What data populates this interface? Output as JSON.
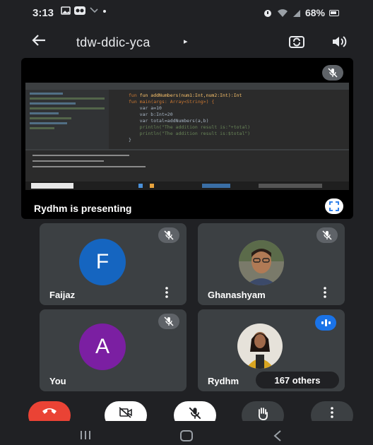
{
  "status_bar": {
    "time": "3:13",
    "battery": "68%",
    "left_icons": [
      "gallery-icon",
      "teams-icon",
      "signal-tool-icon",
      "dot-icon"
    ],
    "right_icons": [
      "alarm-icon",
      "wifi-icon",
      "signal-icon",
      "battery-icon"
    ]
  },
  "header": {
    "meeting_code": "tdw-ddic-yca",
    "caret": "▸"
  },
  "presentation": {
    "presenter_text": "Rydhm  is presenting",
    "code_lines": [
      "fun addNumbers(num1:Int,num2:Int):Int",
      "fun main(args: Array<String>) {",
      "    var a=10",
      "    var b:Int=20",
      "    var total=addNumbers(a,b)",
      "    println(\"The addition result is:\"+total)",
      "    println(\"The addition result is:$total\")",
      "}"
    ]
  },
  "participants": [
    {
      "name": "Faijaz",
      "initial": "F",
      "avatar_color": "#1565c0",
      "muted": true
    },
    {
      "name": "Ghanashyam",
      "initial": "",
      "avatar_color": "#6d5a4a",
      "muted": true
    },
    {
      "name": "You",
      "initial": "A",
      "avatar_color": "#7b1fa2",
      "muted": true
    },
    {
      "name": "Rydhm",
      "initial": "",
      "avatar_color": "#c8b79a",
      "muted": false,
      "speaking": true
    }
  ],
  "others_count": "167 others",
  "controls": {
    "end_call_color": "#ea4335",
    "buttons": [
      "end-call",
      "camera-off",
      "mic-off",
      "raise-hand",
      "more-options"
    ]
  },
  "colors": {
    "background": "#202124",
    "tile": "#3c4043",
    "accent": "#1a73e8"
  }
}
